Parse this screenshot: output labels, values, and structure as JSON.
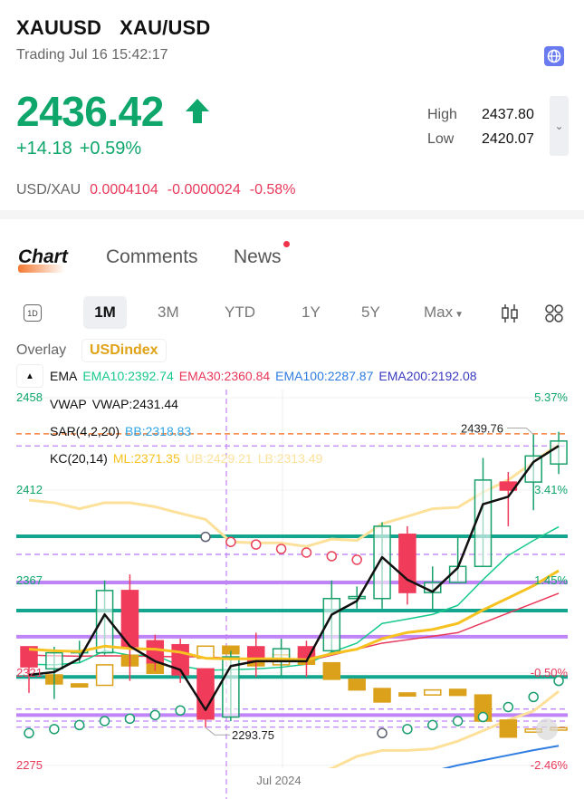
{
  "header": {
    "symbol": "XAUUSD",
    "name": "XAU/USD",
    "status": "Trading Jul 16 15:42:17",
    "price": "2436.42",
    "change": "+14.18",
    "change_pct": "+0.59%",
    "high_label": "High",
    "high": "2437.80",
    "low_label": "Low",
    "low": "2420.07",
    "inverse_pair": "USD/XAU",
    "inverse_price": "0.0004104",
    "inverse_change": "-0.0000024",
    "inverse_pct": "-0.58%",
    "up_color": "#0ea66b",
    "down_color": "#e8385a"
  },
  "tabs": [
    {
      "label": "Chart",
      "active": true
    },
    {
      "label": "Comments"
    },
    {
      "label": "News",
      "badge": true
    }
  ],
  "periods": {
    "intraday": "1D",
    "items": [
      "1M",
      "3M",
      "YTD",
      "1Y",
      "5Y",
      "Max"
    ],
    "selected": "1M"
  },
  "overlay": {
    "label": "Overlay",
    "value": "USDindex"
  },
  "indicators": {
    "ema": {
      "label": "EMA",
      "items": [
        {
          "text": "EMA10:2392.74",
          "color": "#17c98a"
        },
        {
          "text": "EMA30:2360.84",
          "color": "#e8385a"
        },
        {
          "text": "EMA100:2287.87",
          "color": "#2f7de1"
        },
        {
          "text": "EMA200:2192.08",
          "color": "#3a3ac0"
        }
      ]
    },
    "vwap": {
      "label": "VWAP",
      "value": "VWAP:2431.44"
    },
    "sar": {
      "label": "SAR(4,2,20)",
      "value": "BB:2318.83"
    },
    "kc": {
      "label": "KC(20,14)",
      "ml": "ML:2371.35",
      "ub": "UB:2429.21",
      "lb": "LB:2313.49"
    }
  },
  "chart_data": {
    "type": "candlestick",
    "yticks_left": [
      "2458",
      "2412",
      "2367",
      "2321",
      "2275"
    ],
    "yticks_right": [
      "5.37%",
      "3.41%",
      "1.45%",
      "-0.50%",
      "-2.46%"
    ],
    "ylim": [
      2275,
      2458
    ],
    "xlabel_tick": "Jul 2024",
    "max_label": "2439.76",
    "min_label": "2293.75",
    "candles": [
      [
        2334,
        2334,
        2311,
        2324
      ],
      [
        2323,
        2334,
        2308,
        2331
      ],
      [
        2331,
        2337,
        2326,
        2332
      ],
      [
        2331,
        2367,
        2330,
        2362
      ],
      [
        2362,
        2370,
        2317,
        2334
      ],
      [
        2337,
        2340,
        2322,
        2326
      ],
      [
        2335,
        2338,
        2316,
        2320
      ],
      [
        2323,
        2323,
        2293.75,
        2298
      ],
      [
        2299,
        2332,
        2297,
        2329
      ],
      [
        2334,
        2341,
        2319,
        2327
      ],
      [
        2327,
        2338,
        2319,
        2333
      ],
      [
        2334,
        2337,
        2319,
        2328
      ],
      [
        2332,
        2367,
        2331,
        2358
      ],
      [
        2358,
        2364,
        2353,
        2359
      ],
      [
        2358,
        2396,
        2353,
        2394
      ],
      [
        2390,
        2394,
        2355,
        2361
      ],
      [
        2361,
        2374,
        2352,
        2366
      ],
      [
        2366,
        2389,
        2366,
        2374
      ],
      [
        2374,
        2428,
        2374,
        2417
      ],
      [
        2416,
        2421,
        2394,
        2412
      ],
      [
        2416,
        2439.76,
        2402,
        2429
      ],
      [
        2425,
        2441,
        2420,
        2436.42
      ]
    ],
    "usdindex_candles": [
      [
        null,
        null,
        false
      ],
      [
        2320,
        2315.5,
        true
      ],
      [
        2315.5,
        2314,
        true
      ],
      [
        2325,
        2314.8,
        false
      ],
      [
        2329.8,
        2324.5,
        true
      ],
      [
        2329.8,
        2320.8,
        true
      ],
      [
        2324.5,
        2320.8,
        true
      ],
      [
        2334.3,
        2328.3,
        false
      ],
      [
        2334.3,
        2330.5,
        true
      ],
      [
        2331,
        2324.5,
        true
      ],
      [
        2330,
        2325,
        false
      ],
      [
        2330.5,
        2325.3,
        true
      ],
      [
        2326,
        2317.8,
        true
      ],
      [
        2317.8,
        2312.5,
        true
      ],
      [
        2313.2,
        2306.5,
        true
      ],
      [
        2311,
        2309.5,
        true
      ],
      [
        2312.5,
        2310,
        false
      ],
      [
        2312.8,
        2309.8,
        true
      ],
      [
        2310,
        2297,
        true
      ],
      [
        2297.5,
        2289,
        true
      ],
      [
        2293,
        2291.5,
        false
      ],
      [
        2293.7,
        2292.5,
        false
      ]
    ],
    "vwap_line": [
      2320,
      2321.4,
      2328.1,
      2350.1,
      2334.3,
      2326.8,
      2322.5,
      2302.6,
      2324.4,
      2326.8,
      2326.8,
      2326.8,
      2350,
      2356.8,
      2378.6,
      2367.4,
      2361.4,
      2373.3,
      2405,
      2408.7,
      2426,
      2434
    ],
    "kc_ml": [
      2332.8,
      2332,
      2331.6,
      2334.3,
      2333.1,
      2332.8,
      2331.3,
      2328.3,
      2328,
      2328,
      2328,
      2327.5,
      2330.5,
      2332.8,
      2338,
      2341.1,
      2342.6,
      2345.6,
      2352.3,
      2358.3,
      2364.4,
      2371.9
    ],
    "kc_ub": [
      2407,
      2405.7,
      2402.7,
      2405.7,
      2405.7,
      2403.7,
      2400.4,
      2397.4,
      2386.2,
      2385.7,
      2385.7,
      2383.9,
      2387.6,
      2386.9,
      2395.2,
      2398.9,
      2402.7,
      2403.4,
      2410.9,
      2417,
      2426,
      2435
    ],
    "kc_lb": [
      null,
      null,
      null,
      null,
      null,
      null,
      null,
      null,
      null,
      null,
      null,
      2270.4,
      2273.4,
      2279.4,
      2282.4,
      2282.4,
      2283.2,
      2287,
      2292.2,
      2297.5,
      2302,
      2311.8
    ],
    "ema10": [
      2325.3,
      2325,
      2326,
      2332,
      2329.8,
      2329.8,
      2324.5,
      2322.3,
      2322.6,
      2323,
      2323.8,
      2325.3,
      2331.3,
      2335.8,
      2345.6,
      2347.8,
      2350.1,
      2354.6,
      2367.4,
      2379.4,
      2386.9,
      2393.7
    ],
    "ema30": [
      2329.8,
      2329.5,
      2329.3,
      2329.5,
      2329.4,
      2329.2,
      2329,
      2329,
      2328.2,
      2327.6,
      2327.2,
      2326.8,
      2329.8,
      2332.8,
      2335.8,
      2337.5,
      2339.2,
      2341,
      2345.9,
      2350.8,
      2355.7,
      2360.6
    ],
    "ema100": [
      null,
      null,
      null,
      null,
      null,
      null,
      null,
      null,
      null,
      null,
      null,
      null,
      null,
      null,
      null,
      null,
      2272,
      2275,
      2277.5,
      2280,
      2282.5,
      2284.7
    ],
    "sar": [
      [
        2291,
        "up"
      ],
      [
        2293,
        "up"
      ],
      [
        2295,
        "up"
      ],
      [
        2297,
        "up"
      ],
      [
        2298.2,
        "up"
      ],
      [
        2300,
        "up"
      ],
      [
        2302.3,
        "up"
      ],
      [
        2388.7,
        "flip"
      ],
      [
        2386.2,
        "down"
      ],
      [
        2384.9,
        "down"
      ],
      [
        2382.7,
        "down"
      ],
      [
        2380.9,
        "down"
      ],
      [
        2379.1,
        "down"
      ],
      [
        2377.3,
        "down"
      ],
      [
        2291,
        "flip"
      ],
      [
        2293,
        "up"
      ],
      [
        2295,
        "up"
      ],
      [
        2297,
        "up"
      ],
      [
        2299,
        "up"
      ],
      [
        2304,
        "up"
      ],
      [
        2309,
        "up"
      ],
      [
        2317,
        "up"
      ]
    ],
    "support_levels": [
      2389,
      2352,
      2319
    ],
    "resistance_levels": [
      2366,
      2339,
      2300
    ],
    "dashed_levels": [
      2434,
      2380,
      2303,
      2297,
      2294
    ],
    "last_price_level": 2440,
    "colors": {
      "up": "#18a06b",
      "down": "#f03c5a",
      "usdindex": "#dba11a",
      "vwap": "#111111",
      "kc_ml": "#f7c220",
      "kc_band": "#fde19a",
      "ema10": "#17c98a",
      "ema30": "#e8385a",
      "ema100": "#2f7de1",
      "support": "#13a58e",
      "resistance": "#bf84f7",
      "sar_up": "#1a9e6e",
      "sar_down": "#e8435a",
      "sar_flip": "#5a6070"
    }
  }
}
